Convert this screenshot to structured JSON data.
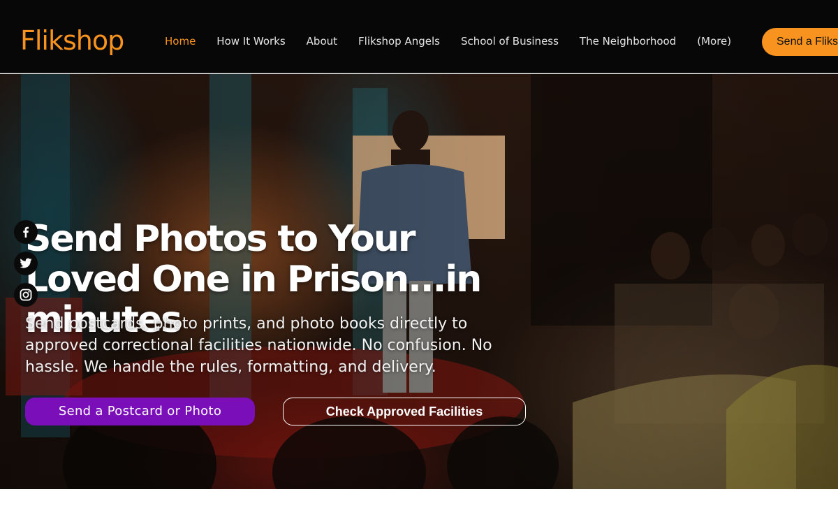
{
  "brand": {
    "logo_text": "Flikshop",
    "accent_color": "#f7931e",
    "purple_color": "#7a0eb8"
  },
  "nav": {
    "items": [
      {
        "label": "Home",
        "active": true
      },
      {
        "label": "How It Works"
      },
      {
        "label": "About"
      },
      {
        "label": "Flikshop Angels"
      },
      {
        "label": "School of Business"
      },
      {
        "label": "The Neighborhood"
      },
      {
        "label": "(More)"
      }
    ],
    "cta_label": "Send a Flikshop"
  },
  "hero": {
    "headline": "Send Photos to Your Loved One in Prison...in minutes",
    "subtext": "Send postcards, photo prints, and photo books directly to approved correctional facilities nationwide. No confusion. No hassle. We handle the rules, formatting, and delivery.",
    "primary_button": "Send a Postcard or Photo",
    "secondary_button": "Check Approved Facilities"
  },
  "social": [
    {
      "icon": "facebook-icon"
    },
    {
      "icon": "twitter-icon"
    },
    {
      "icon": "instagram-icon"
    }
  ]
}
